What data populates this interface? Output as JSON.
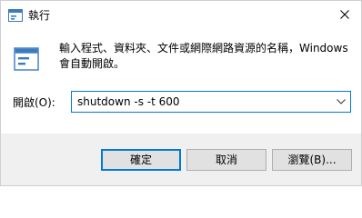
{
  "window": {
    "title": "執行"
  },
  "dialog": {
    "description": "輸入程式、資料夾、文件或網際網路資源的名稱，Windows\n會自動開啟。",
    "open_label": "開啟(O):",
    "command_value": "shutdown -s -t 600"
  },
  "buttons": {
    "ok": "確定",
    "cancel": "取消",
    "browse": "瀏覽(B)..."
  },
  "icons": {
    "title": "run-app-icon",
    "close": "close-icon",
    "main": "run-app-icon",
    "dropdown": "chevron-down-icon"
  },
  "colors": {
    "accent": "#0078d7",
    "footer_bg": "#f0f0f0",
    "button_bg": "#e1e1e1"
  }
}
